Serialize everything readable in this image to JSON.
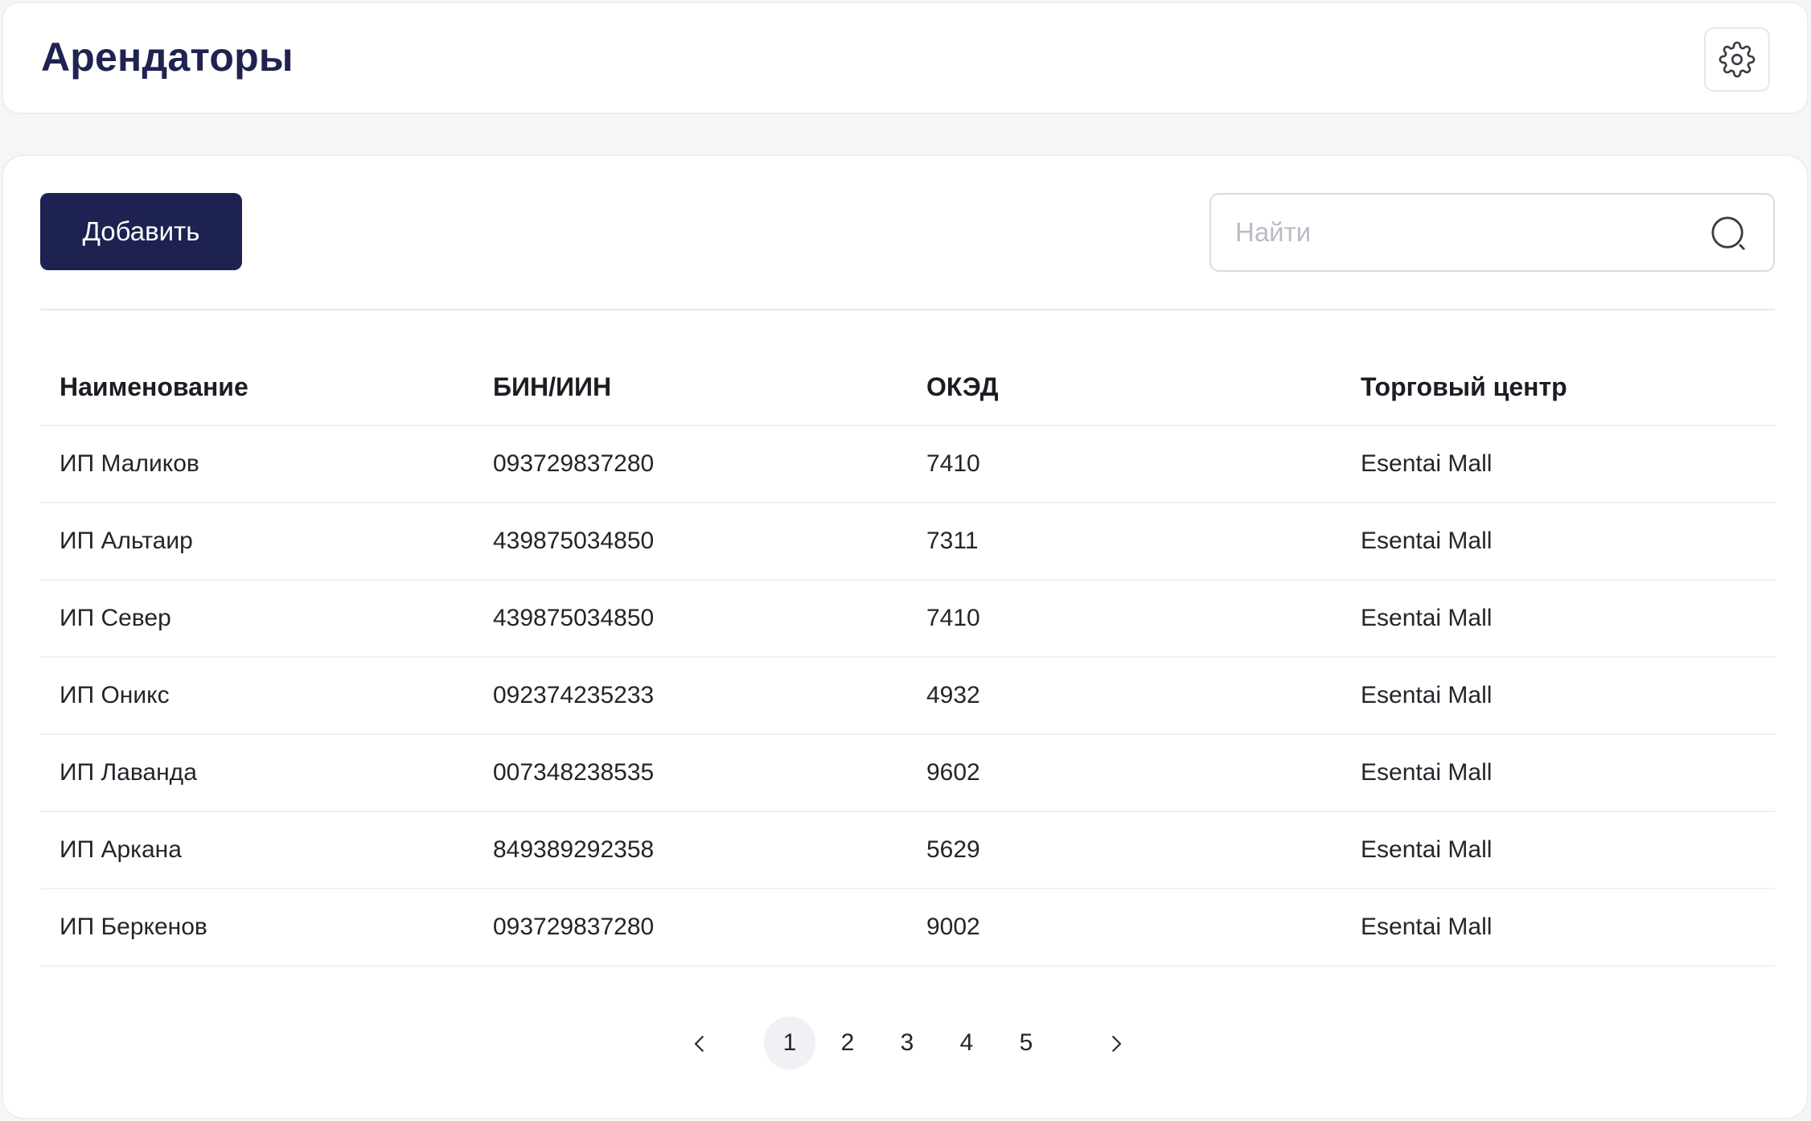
{
  "header": {
    "title": "Арендаторы",
    "settings_icon": "gear-icon"
  },
  "toolbar": {
    "add_label": "Добавить",
    "search_placeholder": "Найти",
    "search_value": "",
    "search_icon": "search-icon"
  },
  "table": {
    "columns": [
      "Наименование",
      "БИН/ИИН",
      "ОКЭД",
      "Торговый центр"
    ],
    "rows": [
      [
        "ИП Маликов",
        "093729837280",
        "7410",
        "Esentai Mall"
      ],
      [
        "ИП Альтаир",
        "439875034850",
        "7311",
        "Esentai Mall"
      ],
      [
        "ИП Север",
        "439875034850",
        "7410",
        "Esentai Mall"
      ],
      [
        "ИП Оникс",
        "092374235233",
        "4932",
        "Esentai Mall"
      ],
      [
        "ИП Лаванда",
        "007348238535",
        "9602",
        "Esentai Mall"
      ],
      [
        "ИП Аркана",
        "849389292358",
        "5629",
        "Esentai Mall"
      ],
      [
        "ИП Беркенов",
        "093729837280",
        "9002",
        "Esentai Mall"
      ]
    ]
  },
  "pagination": {
    "pages": [
      "1",
      "2",
      "3",
      "4",
      "5"
    ],
    "current": "1",
    "prev_icon": "chevron-left-icon",
    "next_icon": "chevron-right-icon"
  },
  "colors": {
    "primary": "#1d2250",
    "title": "#1f2350",
    "active_page_bg": "#f0f1f4"
  }
}
